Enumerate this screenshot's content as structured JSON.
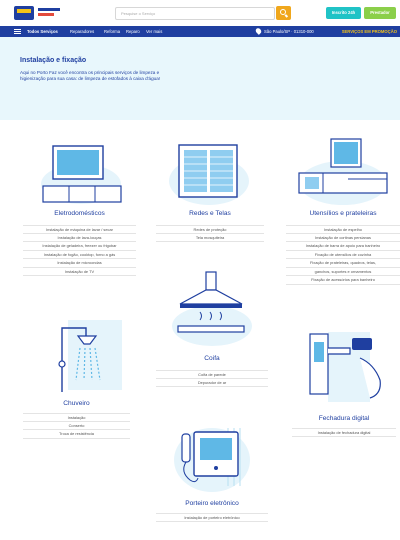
{
  "header": {
    "logo_icon": "porto-faz-logo",
    "search_placeholder": "Pesquise o Serviço",
    "btn_signup": "Inscrito 24h",
    "btn_register": "Prestador",
    "accent_blue": "#1f3fa0",
    "accent_yellow": "#f3c318"
  },
  "nav": {
    "all_services": "Todos Serviços",
    "links": [
      "Reparadores",
      "Reforma",
      "Reparo",
      "Ver mais"
    ],
    "location": "São Paulo/SP · 01310-000",
    "promo": "SERVIÇOS EM PROMOÇÃO"
  },
  "banner": {
    "title": "Instalação e fixação",
    "text": "Aqui no Porto Faz você encontra os principais serviços de limpeza e higienização para sua casa: de limpeza de estofados à caixa d'água!"
  },
  "categories": {
    "eletro": {
      "title": "Eletrodomésticos",
      "items": [
        "Instalação de máquina de lavar / secar",
        "Instalação de lava-louças",
        "Instalação de geladeira, freezer ou frigobar",
        "Instalação de fogão, cooktop, forno a gás",
        "Instalação de microondas",
        "Instalação de TV"
      ]
    },
    "redes": {
      "title": "Redes e Telas",
      "items": [
        "Redes de proteção",
        "Tela mosquiteira"
      ]
    },
    "utensilios": {
      "title": "Utensílios e prateleiras",
      "items": [
        "Instalação de espelho",
        "Instalação de cortinas persianas",
        "Instalação de barra de apoio para banheiro",
        "Fixação de utensílios de cozinha",
        "Fixação de prateleiras, quadros, telas,",
        "ganchos, suportes e ornamentos",
        "Fixação de acessórios para banheiro"
      ]
    },
    "coifa": {
      "title": "Coifa",
      "items": [
        "Coifa de parede",
        "Depurador de ar"
      ]
    },
    "chuveiro": {
      "title": "Chuveiro",
      "items": [
        "Instalação",
        "Conserto",
        "Troca de resistência"
      ]
    },
    "fechadura": {
      "title": "Fechadura digital",
      "items": [
        "Instalação de fechadura digital"
      ]
    },
    "porteiro": {
      "title": "Porteiro eletrônico",
      "items": [
        "Instalação de porteiro eletrônico"
      ]
    }
  }
}
